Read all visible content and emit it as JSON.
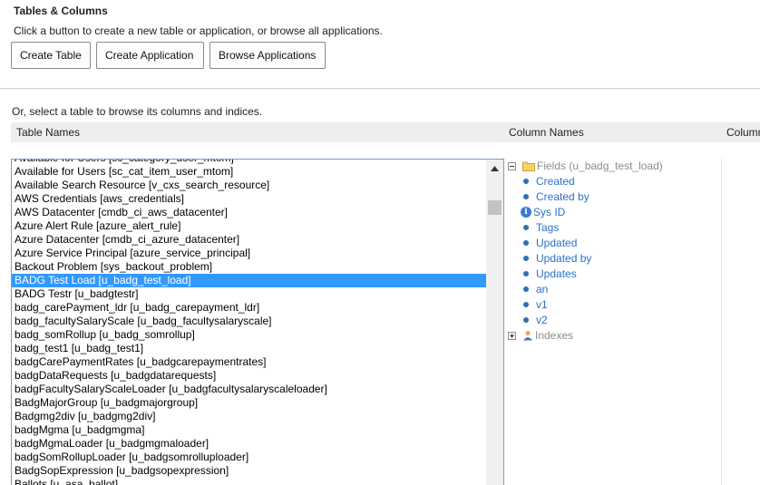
{
  "header": {
    "title": "Tables & Columns",
    "description": "Click a button to create a new table or application, or browse all applications."
  },
  "buttons": {
    "create_table": "Create Table",
    "create_application": "Create Application",
    "browse_applications": "Browse Applications"
  },
  "select_hint": "Or, select a table to browse its columns and indices.",
  "columns": {
    "table_names": "Table Names",
    "column_names": "Column Names",
    "column_extra": "Column"
  },
  "tables": [
    "Available for Users [sc_category_user_mtom]",
    "Available for Users [sc_cat_item_user_mtom]",
    "Available Search Resource [v_cxs_search_resource]",
    "AWS Credentials [aws_credentials]",
    "AWS Datacenter [cmdb_ci_aws_datacenter]",
    "Azure Alert Rule [azure_alert_rule]",
    "Azure Datacenter [cmdb_ci_azure_datacenter]",
    "Azure Service Principal [azure_service_principal]",
    "Backout Problem [sys_backout_problem]",
    "BADG Test Load [u_badg_test_load]",
    "BADG Testr [u_badgtestr]",
    "badg_carePayment_ldr [u_badg_carepayment_ldr]",
    "badg_facultySalaryScale [u_badg_facultysalaryscale]",
    "badg_somRollup [u_badg_somrollup]",
    "badg_test1 [u_badg_test1]",
    "badgCarePaymentRates [u_badgcarepaymentrates]",
    "badgDataRequests [u_badgdatarequests]",
    "badgFacultySalaryScaleLoader [u_badgfacultysalaryscaleloader]",
    "BadgMajorGroup [u_badgmajorgroup]",
    "Badgmg2div [u_badgmg2div]",
    "badgMgma [u_badgmgma]",
    "badgMgmaLoader [u_badgmgmaloader]",
    "badgSomRollupLoader [u_badgsomrolluploader]",
    "BadgSopExpression [u_badgsopexpression]",
    "Ballots [u_asa_ballot]"
  ],
  "selected_table": "BADG Test Load [u_badg_test_load]",
  "tree": {
    "fields_label": "Fields (u_badg_test_load)",
    "fields": [
      "Created",
      "Created by",
      "Sys ID",
      "Tags",
      "Updated",
      "Updated by",
      "Updates",
      "an",
      "v1",
      "v2"
    ],
    "indexes_label": "Indexes"
  },
  "colors": {
    "selection": "#3399ff",
    "link": "#2a72c8",
    "border": "#7a9cc6"
  }
}
